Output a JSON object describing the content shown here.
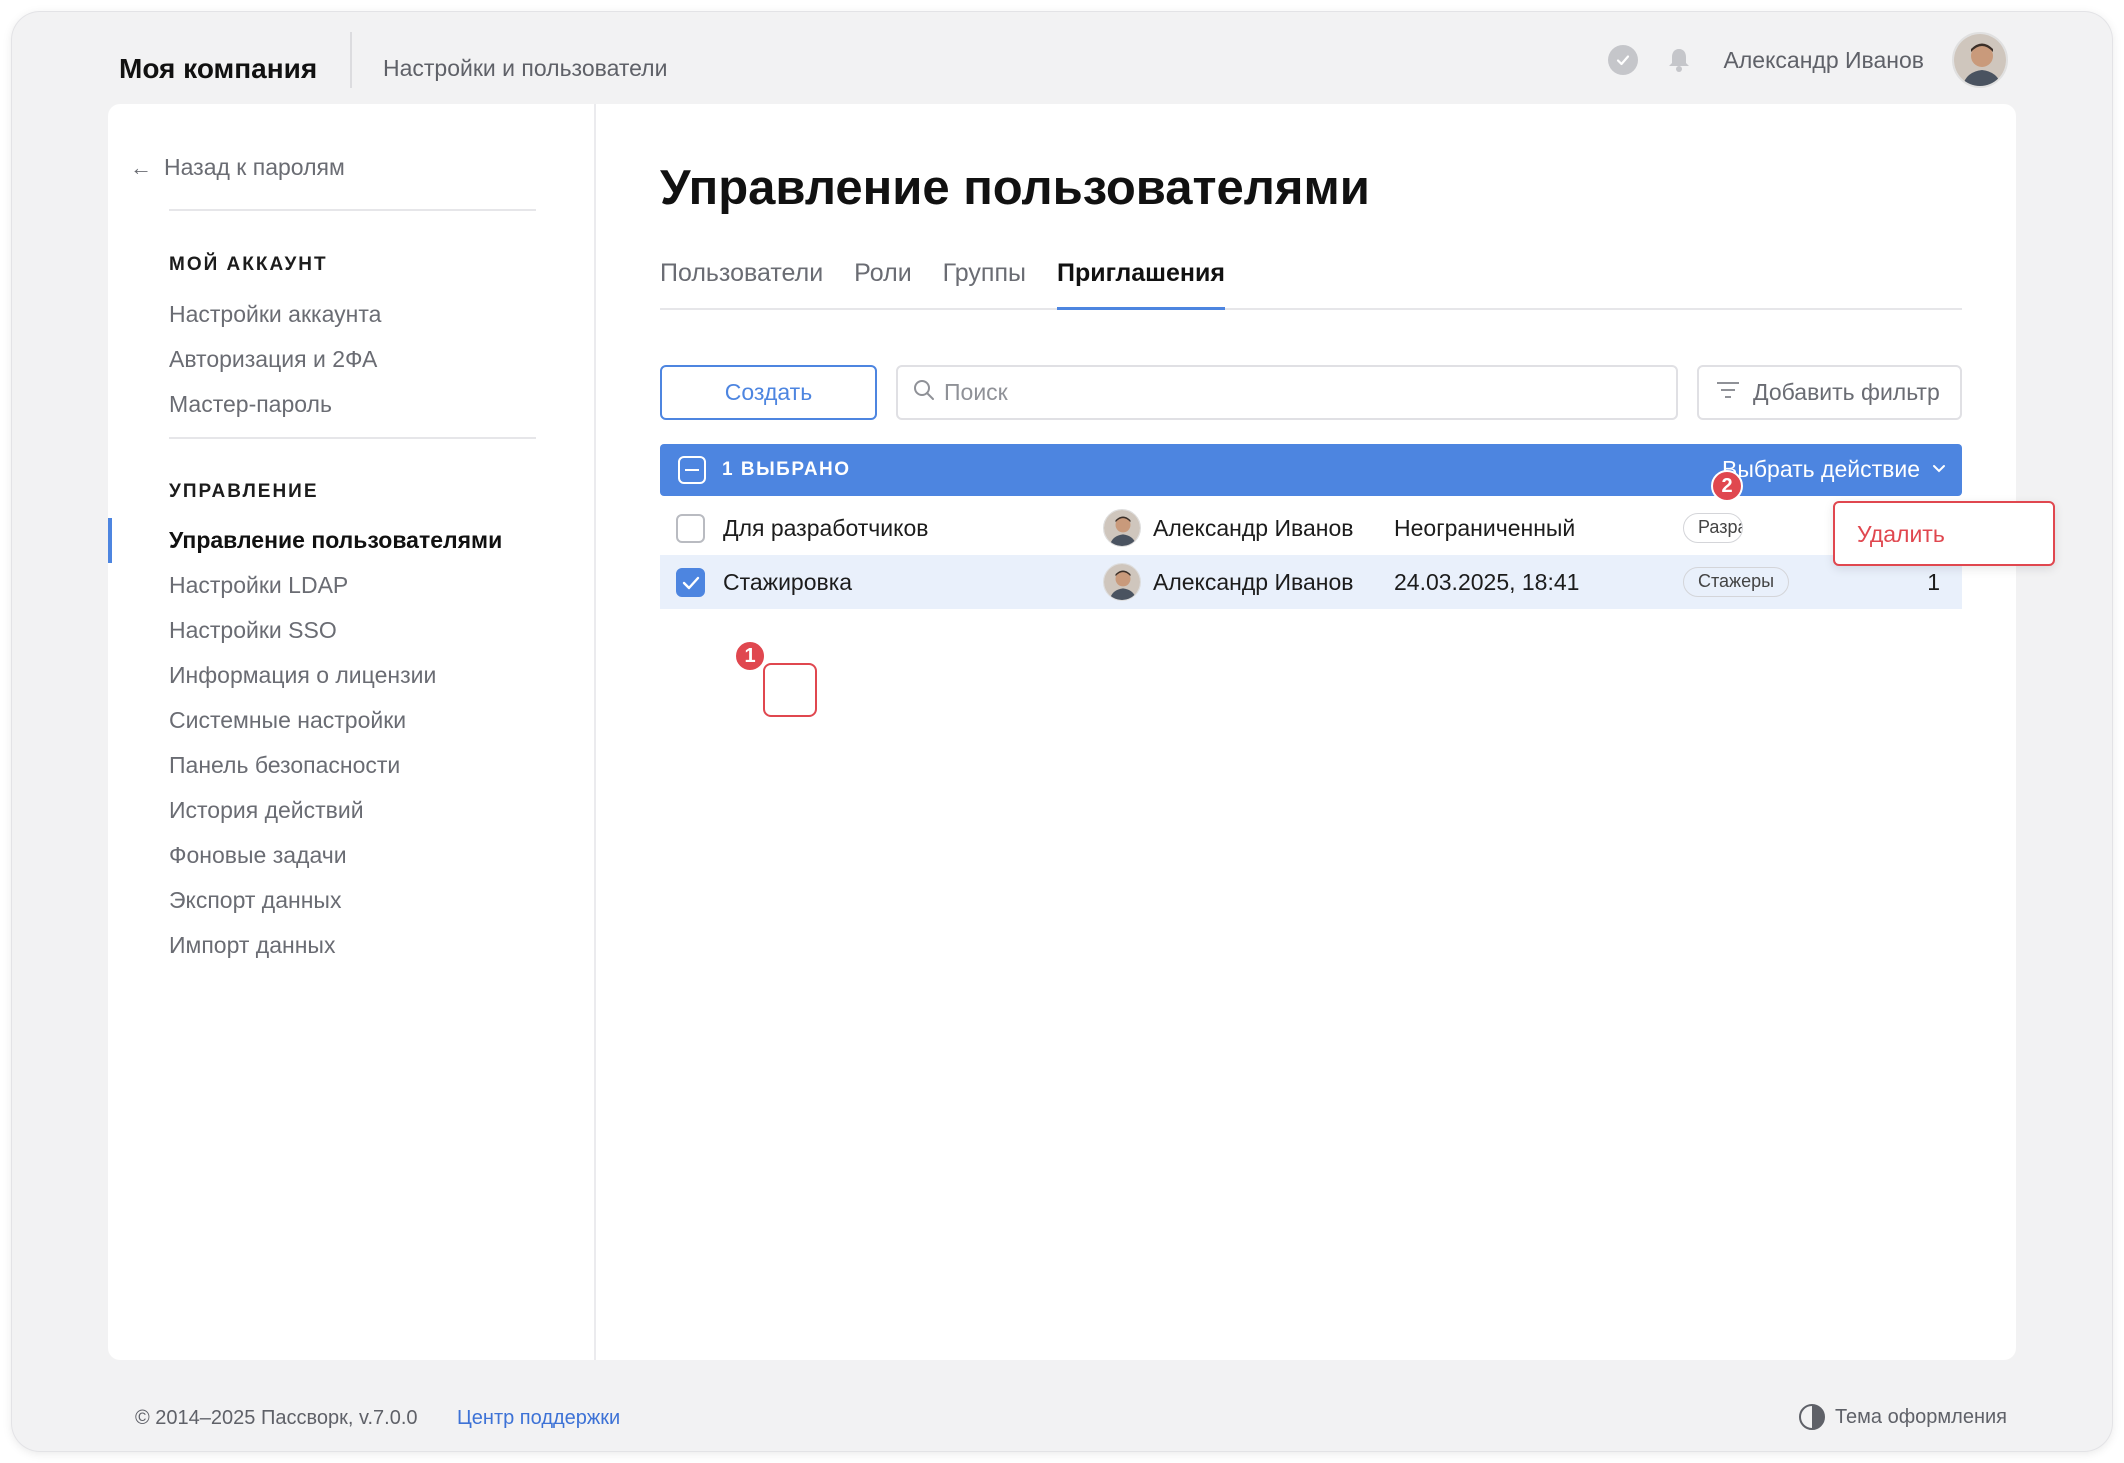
{
  "header": {
    "brand": "Моя компания",
    "section": "Настройки и пользователи",
    "user_name": "Александр Иванов"
  },
  "sidebar": {
    "back_label": "Назад к паролям",
    "account_heading": "МОЙ АККАУНТ",
    "account_items": [
      {
        "label": "Настройки аккаунта"
      },
      {
        "label": "Авторизация и 2ФА"
      },
      {
        "label": "Мастер-пароль"
      }
    ],
    "admin_heading": "УПРАВЛЕНИЕ",
    "admin_items": [
      {
        "label": "Управление пользователями",
        "active": true
      },
      {
        "label": "Настройки LDAP"
      },
      {
        "label": "Настройки SSO"
      },
      {
        "label": "Информация о лицензии"
      },
      {
        "label": "Системные настройки"
      },
      {
        "label": "Панель безопасности"
      },
      {
        "label": "История действий"
      },
      {
        "label": "Фоновые задачи"
      },
      {
        "label": "Экспорт данных"
      },
      {
        "label": "Импорт данных"
      }
    ]
  },
  "main": {
    "title": "Управление пользователями",
    "tabs": [
      {
        "label": "Пользователи"
      },
      {
        "label": "Роли"
      },
      {
        "label": "Группы"
      },
      {
        "label": "Приглашения",
        "active": true
      }
    ],
    "create_label": "Создать",
    "search_placeholder": "Поиск",
    "filter_label": "Добавить фильтр",
    "selection": {
      "count_label": "1 ВЫБРАНО",
      "action_label": "Выбрать действие"
    },
    "rows": [
      {
        "name": "Для разработчиков",
        "owner": "Александр Иванов",
        "expiry": "Неограниченный",
        "group": "Разработчики",
        "count": "",
        "checked": false
      },
      {
        "name": "Стажировка",
        "owner": "Александр Иванов",
        "expiry": "24.03.2025, 18:41",
        "group": "Стажеры",
        "count": "1",
        "checked": true
      }
    ],
    "dropdown": {
      "delete_label": "Удалить"
    },
    "markers": [
      "1",
      "2"
    ]
  },
  "footer": {
    "copyright": "© 2014–2025 Пассворк, v.7.0.0",
    "support": "Центр поддержки",
    "theme": "Тема оформления"
  },
  "colors": {
    "accent": "#4d85e0",
    "danger": "#e0474f"
  }
}
